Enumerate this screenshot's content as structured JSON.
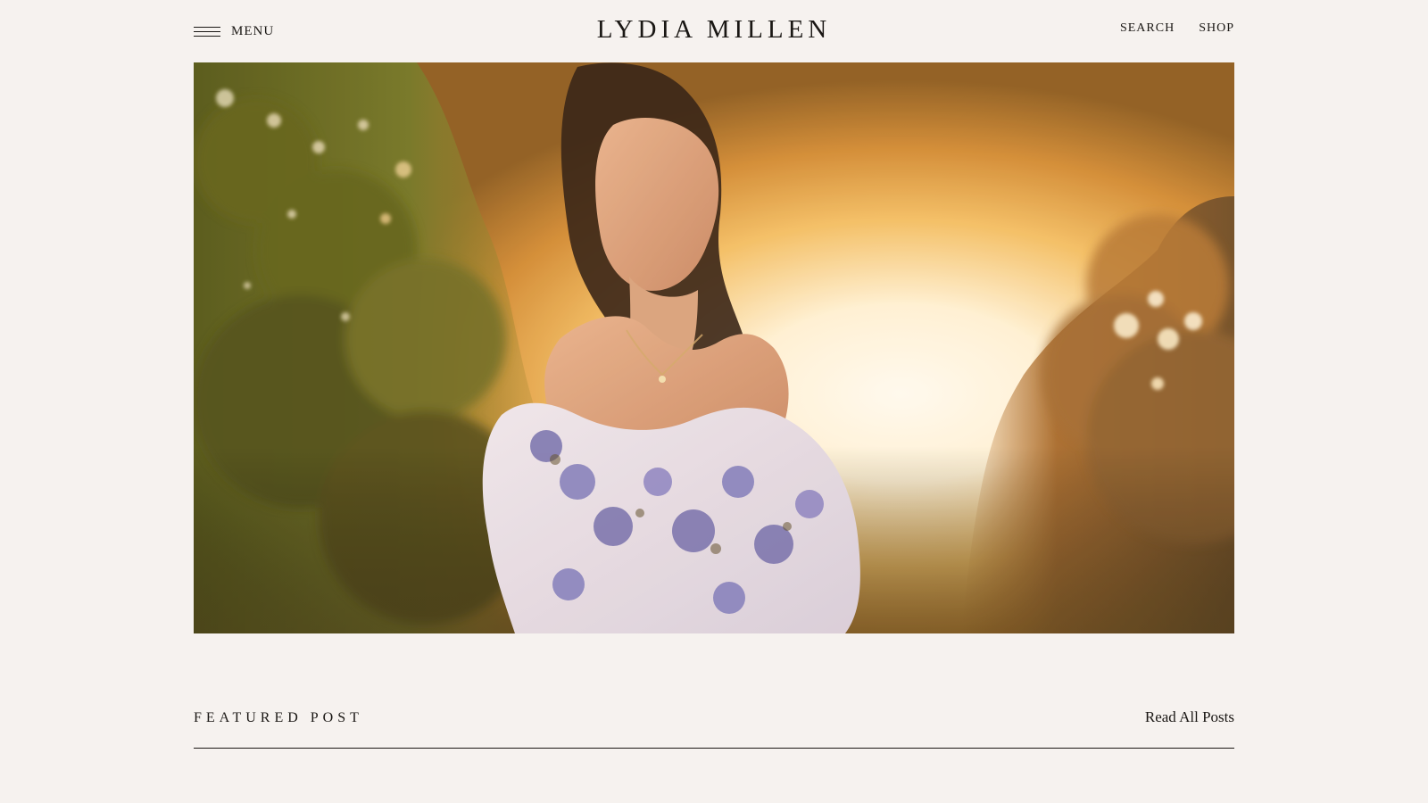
{
  "header": {
    "menu_label": "MENU",
    "logo": "LYDIA MILLEN",
    "nav": [
      {
        "label": "SEARCH"
      },
      {
        "label": "SHOP"
      }
    ]
  },
  "hero": {
    "image_icon": "photo"
  },
  "featured": {
    "title": "FEATURED POST",
    "read_all_label": "Read All Posts"
  },
  "colors": {
    "background": "#f6f2ef",
    "text": "#1a1714",
    "rule": "#1a1714"
  }
}
